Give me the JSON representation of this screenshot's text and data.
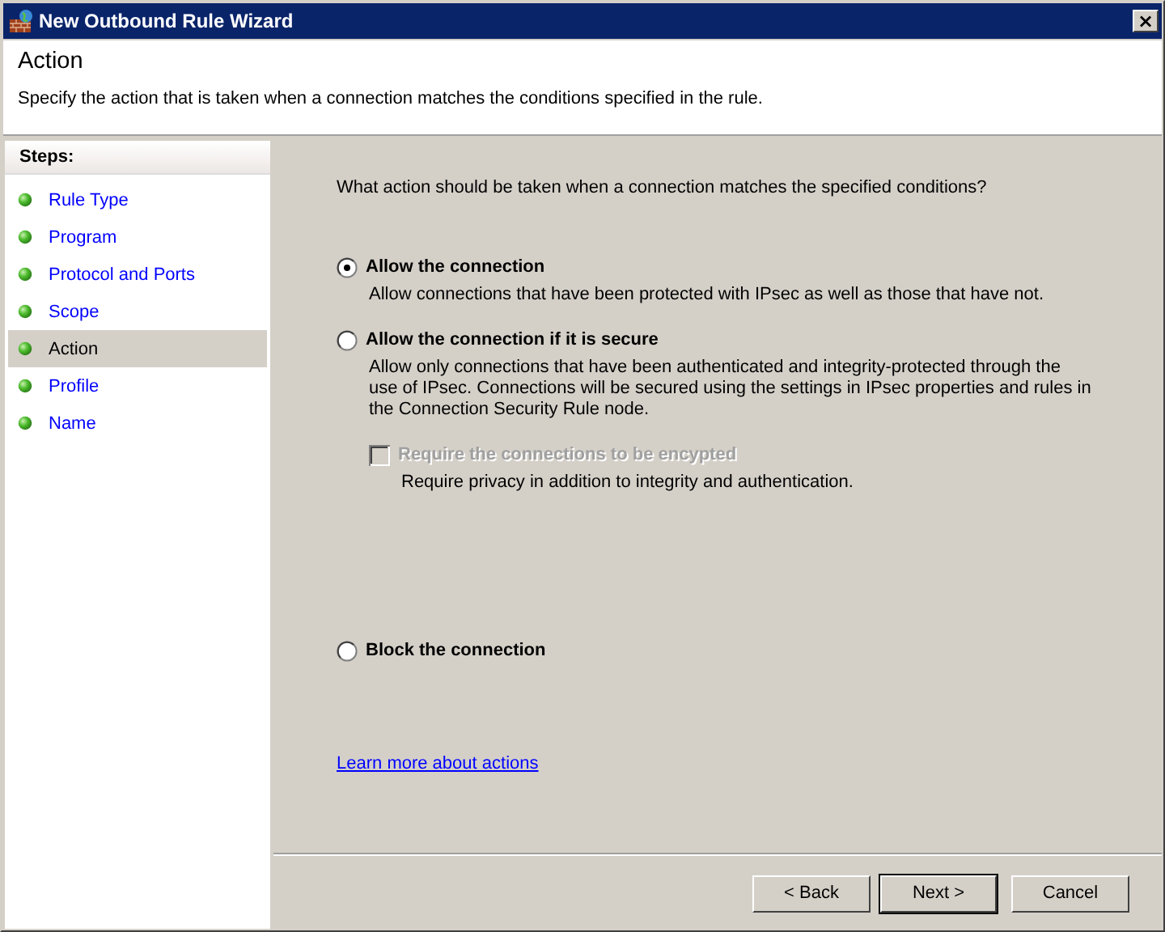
{
  "window": {
    "title": "New Outbound Rule Wizard",
    "close": "×"
  },
  "header": {
    "title": "Action",
    "subtitle": "Specify the action that is taken when a connection matches the conditions specified in the rule."
  },
  "steps": {
    "heading": "Steps:",
    "items": [
      {
        "label": "Rule Type",
        "selected": false
      },
      {
        "label": "Program",
        "selected": false
      },
      {
        "label": "Protocol and Ports",
        "selected": false
      },
      {
        "label": "Scope",
        "selected": false
      },
      {
        "label": "Action",
        "selected": true
      },
      {
        "label": "Profile",
        "selected": false
      },
      {
        "label": "Name",
        "selected": false
      }
    ]
  },
  "content": {
    "question": "What action should be taken when a connection matches the specified conditions?",
    "options": [
      {
        "kind": "radio",
        "label": "Allow the connection",
        "description": "Allow connections that have been protected with IPsec as well as those that have not.",
        "selected": true
      },
      {
        "kind": "radio",
        "label": "Allow the connection if it is secure",
        "description": "Allow only connections that have been authenticated and integrity-protected through the use of IPsec.  Connections will be secured using the settings in IPsec properties and rules in the Connection Security Rule node.",
        "selected": false
      },
      {
        "kind": "checkbox",
        "label": "Require the connections to be encypted",
        "description": "Require privacy in addition to integrity and authentication.",
        "checked": false,
        "disabled": true
      },
      {
        "kind": "radio",
        "label": "Block the connection",
        "selected": false
      }
    ],
    "link": "Learn more about actions"
  },
  "buttons": [
    {
      "label": "< Back",
      "default": false
    },
    {
      "label": "Next >",
      "default": true
    },
    {
      "label": "Cancel",
      "default": false
    }
  ]
}
